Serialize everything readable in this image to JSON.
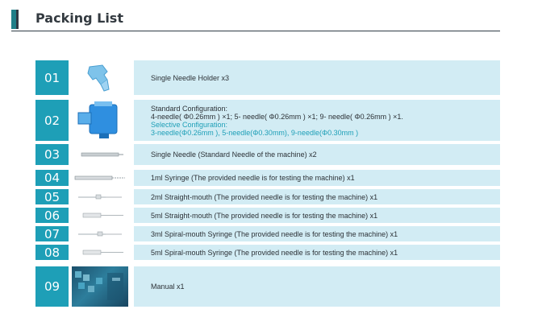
{
  "title": "Packing List",
  "colors": {
    "accent": "#1e9fb7",
    "row_bg": "#d2ecf4",
    "title_text": "#333a40"
  },
  "items": [
    {
      "number": "01",
      "icon": "needle-holder-icon",
      "lines": [
        "Single Needle Holder  x3"
      ]
    },
    {
      "number": "02",
      "icon": "cartridge-icon",
      "lines": [
        "Standard Configuration:",
        "4-needle( Φ0.26mm ) ×1; 5- needle( Φ0.26mm ) ×1; 9- needle( Φ0.26mm ) ×1.",
        "Selective Configuration:",
        "3-needle(Φ0.26mm ), 5-needle(Φ0.30mm), 9-needle(Φ0.30mm )"
      ]
    },
    {
      "number": "03",
      "icon": "single-needle-icon",
      "lines": [
        "Single Needle (Standard Needle of the machine)  x2"
      ]
    },
    {
      "number": "04",
      "icon": "syringe-icon",
      "lines": [
        "1ml Syringe (The provided needle is for testing the machine)  x1"
      ]
    },
    {
      "number": "05",
      "icon": "syringe-icon",
      "lines": [
        "2ml Straight-mouth (The provided needle is for testing the machine)  x1"
      ]
    },
    {
      "number": "06",
      "icon": "syringe-icon",
      "lines": [
        "5ml Straight-mouth (The provided needle is for testing the machine)  x1"
      ]
    },
    {
      "number": "07",
      "icon": "syringe-icon",
      "lines": [
        "3ml Spiral-mouth Syringe (The provided needle is for testing the machine)  x1"
      ]
    },
    {
      "number": "08",
      "icon": "syringe-icon",
      "lines": [
        "5ml Spiral-mouth Syringe (The provided needle is for testing the machine)  x1"
      ]
    },
    {
      "number": "09",
      "icon": "manual-icon",
      "lines": [
        "Manual  x1"
      ]
    }
  ]
}
